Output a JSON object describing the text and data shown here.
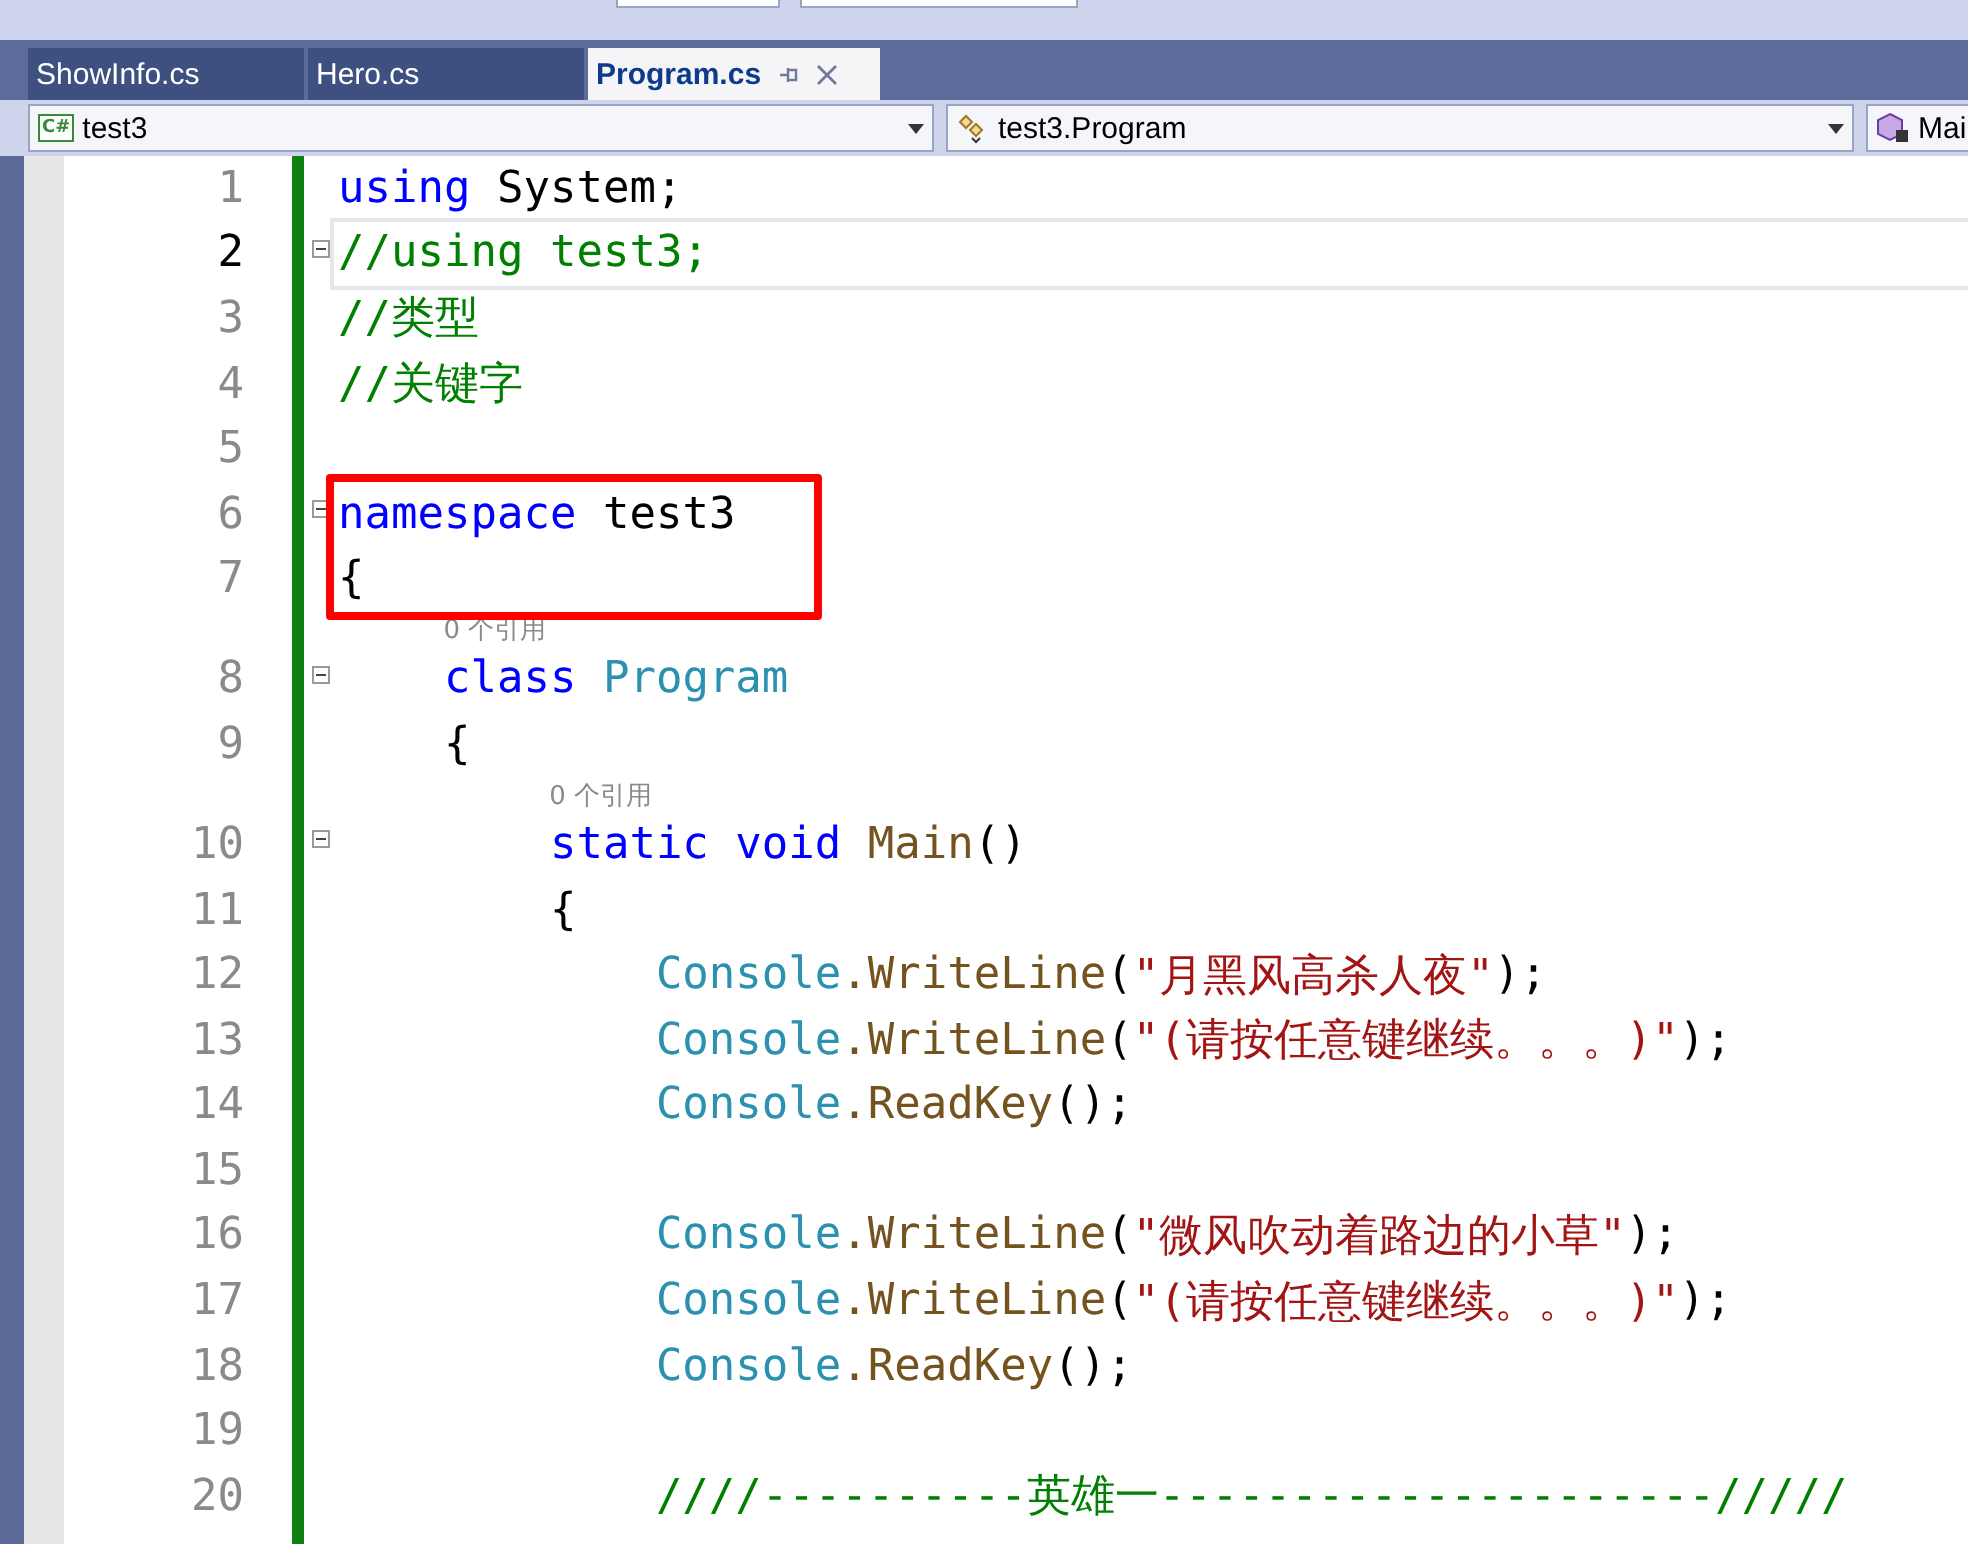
{
  "tabs": [
    {
      "label": "ShowInfo.cs",
      "selected": false
    },
    {
      "label": "Hero.cs",
      "selected": false
    },
    {
      "label": "Program.cs",
      "selected": true
    }
  ],
  "navigation": [
    {
      "kind": "project",
      "badge": "C#",
      "text": "test3"
    },
    {
      "kind": "class",
      "text": "test3.Program"
    },
    {
      "kind": "method",
      "text": "Mai"
    }
  ],
  "editor": {
    "lines": [
      {
        "number": "1",
        "current": false,
        "tokens": [
          {
            "kind": "keyword",
            "text": "using"
          },
          {
            "kind": "plain",
            "text": " System;"
          }
        ]
      },
      {
        "number": "2",
        "current": true,
        "foldable": true,
        "tokens": [
          {
            "kind": "comment",
            "text": "//using test3;"
          }
        ]
      },
      {
        "number": "3",
        "current": false,
        "tokens": [
          {
            "kind": "comment",
            "text": "//类型"
          }
        ]
      },
      {
        "number": "4",
        "current": false,
        "tokens": [
          {
            "kind": "comment",
            "text": "//关键字"
          }
        ]
      },
      {
        "number": "5",
        "current": false
      },
      {
        "number": "6",
        "current": false,
        "foldable": true,
        "boxed": true,
        "tokens": [
          {
            "kind": "keyword",
            "text": "namespace"
          },
          {
            "kind": "plain",
            "text": " test3"
          }
        ]
      },
      {
        "number": "7",
        "current": false,
        "boxed": true,
        "tokens": [
          {
            "kind": "plain",
            "text": "{"
          }
        ]
      },
      {
        "number": "8",
        "current": false,
        "foldable": true,
        "references": "0 个引用",
        "tokens": [
          {
            "kind": "keyword",
            "text": "    class "
          },
          {
            "kind": "type",
            "text": "Program"
          }
        ]
      },
      {
        "number": "9",
        "current": false,
        "tokens": [
          {
            "kind": "plain",
            "text": "    {"
          }
        ]
      },
      {
        "number": "10",
        "current": false,
        "foldable": true,
        "references": "0 个引用",
        "tokens": [
          {
            "kind": "keyword",
            "text": "        static void "
          },
          {
            "kind": "method",
            "text": "Main"
          },
          {
            "kind": "plain",
            "text": "()"
          }
        ]
      },
      {
        "number": "11",
        "current": false,
        "tokens": [
          {
            "kind": "plain",
            "text": "        {"
          }
        ]
      },
      {
        "number": "12",
        "current": false,
        "tokens": [
          {
            "kind": "type",
            "text": "            Console"
          },
          {
            "kind": "method",
            "text": ".WriteLine"
          },
          {
            "kind": "plain",
            "text": "("
          },
          {
            "kind": "string",
            "text": "\"月黑风高杀人夜\""
          },
          {
            "kind": "plain",
            "text": ");"
          }
        ]
      },
      {
        "number": "13",
        "current": false,
        "tokens": [
          {
            "kind": "type",
            "text": "            Console"
          },
          {
            "kind": "method",
            "text": ".WriteLine"
          },
          {
            "kind": "plain",
            "text": "("
          },
          {
            "kind": "string",
            "text": "\"(请按任意键继续。。。)\""
          },
          {
            "kind": "plain",
            "text": ");"
          }
        ]
      },
      {
        "number": "14",
        "current": false,
        "tokens": [
          {
            "kind": "type",
            "text": "            Console"
          },
          {
            "kind": "method",
            "text": ".ReadKey"
          },
          {
            "kind": "plain",
            "text": "();"
          }
        ]
      },
      {
        "number": "15",
        "current": false
      },
      {
        "number": "16",
        "current": false,
        "tokens": [
          {
            "kind": "type",
            "text": "            Console"
          },
          {
            "kind": "method",
            "text": ".WriteLine"
          },
          {
            "kind": "plain",
            "text": "("
          },
          {
            "kind": "string",
            "text": "\"微风吹动着路边的小草\""
          },
          {
            "kind": "plain",
            "text": ");"
          }
        ]
      },
      {
        "number": "17",
        "current": false,
        "tokens": [
          {
            "kind": "type",
            "text": "            Console"
          },
          {
            "kind": "method",
            "text": ".WriteLine"
          },
          {
            "kind": "plain",
            "text": "("
          },
          {
            "kind": "string",
            "text": "\"(请按任意键继续。。。)\""
          },
          {
            "kind": "plain",
            "text": ");"
          }
        ]
      },
      {
        "number": "18",
        "current": false,
        "tokens": [
          {
            "kind": "type",
            "text": "            Console"
          },
          {
            "kind": "method",
            "text": ".ReadKey"
          },
          {
            "kind": "plain",
            "text": "();"
          }
        ]
      },
      {
        "number": "19",
        "current": false
      },
      {
        "number": "20",
        "current": false,
        "tokens": [
          {
            "kind": "comment",
            "text": "            ////----------英雄一---------------------/////"
          }
        ]
      }
    ]
  }
}
